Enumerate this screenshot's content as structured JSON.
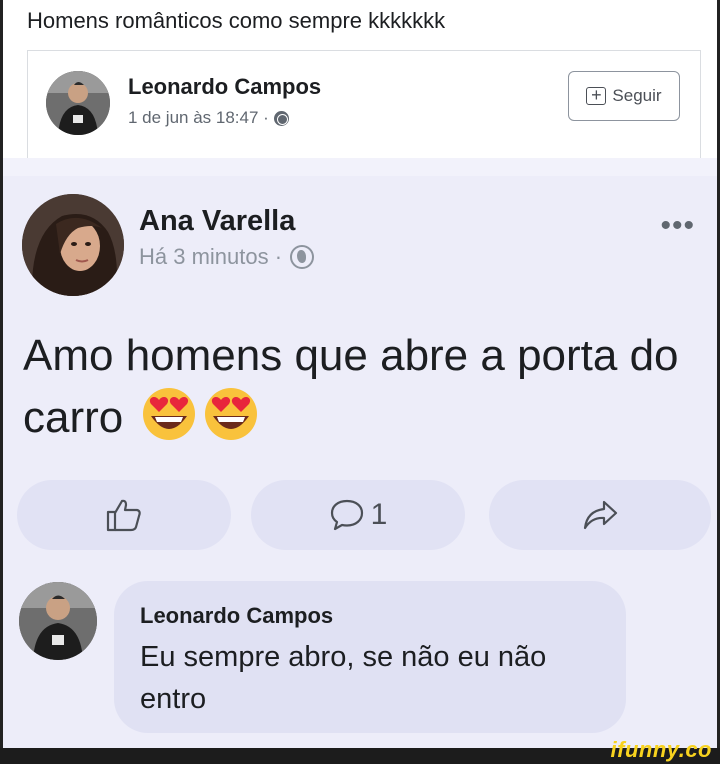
{
  "caption": "Homens românticos como sempre kkkkkkk",
  "shared_header": {
    "author": "Leonardo Campos",
    "date": "1 de jun às 18:47 ·",
    "follow_label": "Seguir"
  },
  "post": {
    "author": "Ana Varella",
    "time": "Há 3 minutos ·",
    "text": "Amo homens que abre a porta do carro",
    "emoji": "heart-eyes-emoji"
  },
  "actions": {
    "like_icon": "thumbs-up-icon",
    "comment_icon": "comment-icon",
    "comment_count": "1",
    "share_icon": "share-icon"
  },
  "comment": {
    "author": "Leonardo Campos",
    "text": "Eu sempre abro, se não eu não entro"
  },
  "watermark": "ifunny.co",
  "colors": {
    "post_bg": "#ededf9",
    "button_bg": "#e1e2f4",
    "text": "#1c1e21",
    "muted": "#8d949e",
    "watermark": "#f7d21e"
  }
}
